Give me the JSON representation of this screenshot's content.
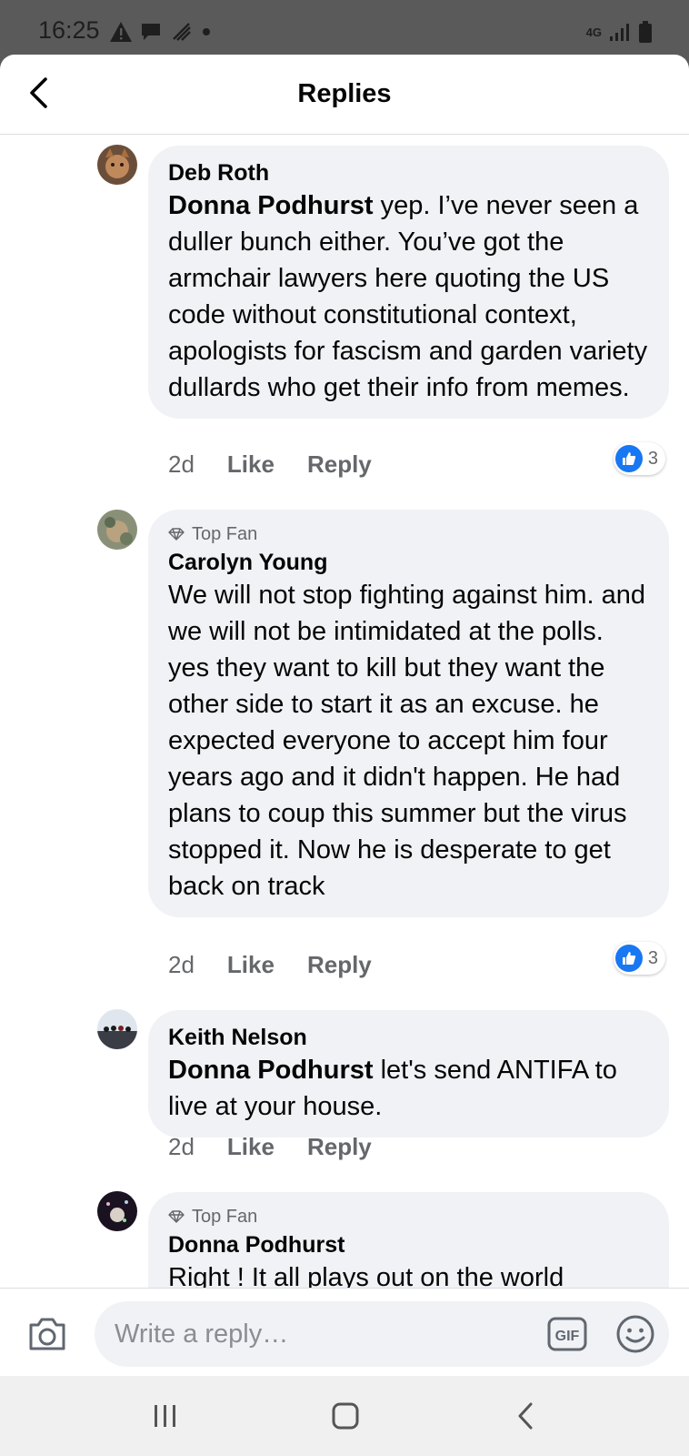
{
  "status_bar": {
    "time": "16:25",
    "network": "4G"
  },
  "header": {
    "title": "Replies"
  },
  "comments": [
    {
      "badge": "",
      "author": "Deb Roth",
      "mention": "Donna Podhurst",
      "text": " yep.  I’ve never seen a duller bunch either.  You’ve got the armchair lawyers here quoting the US code without constitutional context, apologists for fascism and garden variety dullards who get their info from memes.",
      "time": "2d",
      "like_label": "Like",
      "reply_label": "Reply",
      "reaction_count": "3"
    },
    {
      "badge": "Top Fan",
      "author": "Carolyn Young",
      "mention": "",
      "text": "We will not stop fighting against him.  and we will not be intimidated at the polls.  yes they want to kill but they want the other side to start it as an excuse.  he expected everyone to accept him four years ago and it didn't happen.  He had plans to coup this summer but the virus stopped it.  Now he is desperate to get back on track",
      "time": "2d",
      "like_label": "Like",
      "reply_label": "Reply",
      "reaction_count": "3"
    },
    {
      "badge": "",
      "author": "Keith Nelson",
      "mention": "Donna Podhurst",
      "text": " let's send ANTIFA to live at your house.",
      "time": "2d",
      "like_label": "Like",
      "reply_label": "Reply",
      "reaction_count": ""
    },
    {
      "badge": "Top Fan",
      "author": "Donna Podhurst",
      "mention": "",
      "text": "Right ! It all plays out on the world",
      "time": "",
      "like_label": "",
      "reply_label": "",
      "reaction_count": ""
    }
  ],
  "composer": {
    "placeholder": "Write a reply…",
    "gif_label": "GIF"
  },
  "icons": {
    "back": "chevron-left-icon",
    "camera": "camera-icon",
    "gif": "gif-icon",
    "emoji": "smiley-icon",
    "top_fan": "diamond-icon",
    "like": "thumbs-up-icon"
  },
  "colors": {
    "accent": "#1877f2",
    "bubble": "#f0f2f5",
    "secondary_text": "#65676b"
  }
}
